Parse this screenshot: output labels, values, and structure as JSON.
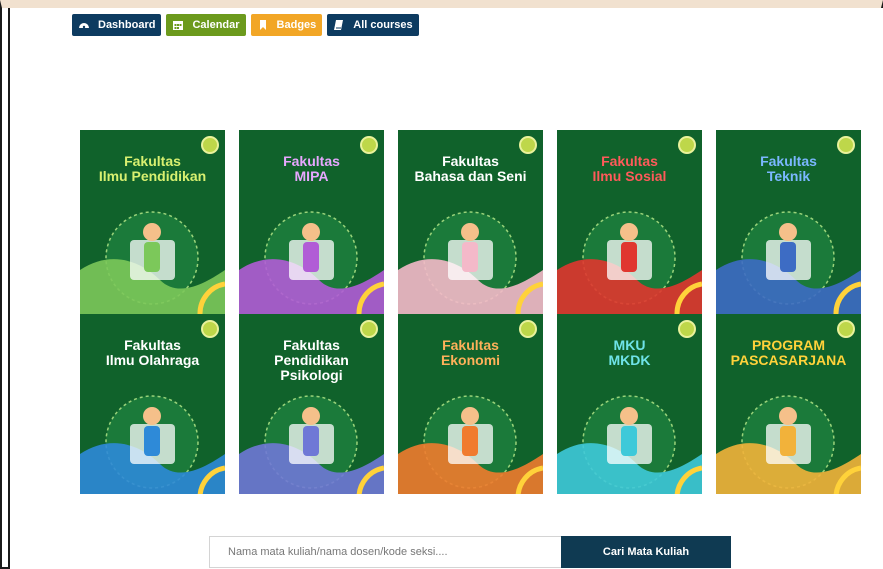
{
  "nav": {
    "dashboard": {
      "label": "Dashboard",
      "icon": "dashboard-icon"
    },
    "calendar": {
      "label": "Calendar",
      "icon": "calendar-icon"
    },
    "badges": {
      "label": "Badges",
      "icon": "bookmark-icon"
    },
    "all_courses": {
      "label": "All courses",
      "icon": "book-icon"
    }
  },
  "faculties": [
    {
      "line1": "Fakultas",
      "line2": "Ilmu Pendidikan",
      "line3": "",
      "title_color": "#d8f070",
      "art_color": "#7cc85a"
    },
    {
      "line1": "Fakultas",
      "line2": "MIPA",
      "line3": "",
      "title_color": "#e7a7ff",
      "art_color": "#b15cd6"
    },
    {
      "line1": "Fakultas",
      "line2": "Bahasa dan Seni",
      "line3": "",
      "title_color": "#ffffff",
      "art_color": "#f4b9c9"
    },
    {
      "line1": "Fakultas",
      "line2": "Ilmu Sosial",
      "line3": "",
      "title_color": "#ff5a5a",
      "art_color": "#e0362f"
    },
    {
      "line1": "Fakultas",
      "line2": "Teknik",
      "line3": "",
      "title_color": "#7bb7ff",
      "art_color": "#3d6cc4"
    },
    {
      "line1": "Fakultas",
      "line2": "Ilmu Olahraga",
      "line3": "",
      "title_color": "#ffffff",
      "art_color": "#2e8ad8"
    },
    {
      "line1": "Fakultas",
      "line2": "Pendidikan",
      "line3": "Psikologi",
      "title_color": "#ffffff",
      "art_color": "#6f78d6"
    },
    {
      "line1": "Fakultas",
      "line2": "Ekonomi",
      "line3": "",
      "title_color": "#ffb15a",
      "art_color": "#f07b2e"
    },
    {
      "line1": "MKU",
      "line2": "MKDK",
      "line3": "",
      "title_color": "#6fe3e8",
      "art_color": "#3ec9d9"
    },
    {
      "line1": "PROGRAM",
      "line2": "PASCASARJANA",
      "line3": "",
      "title_color": "#ffd23a",
      "art_color": "#f2b23a"
    }
  ],
  "search": {
    "placeholder": "Nama mata kuliah/nama dosen/kode seksi....",
    "button_label": "Cari Mata Kuliah"
  }
}
